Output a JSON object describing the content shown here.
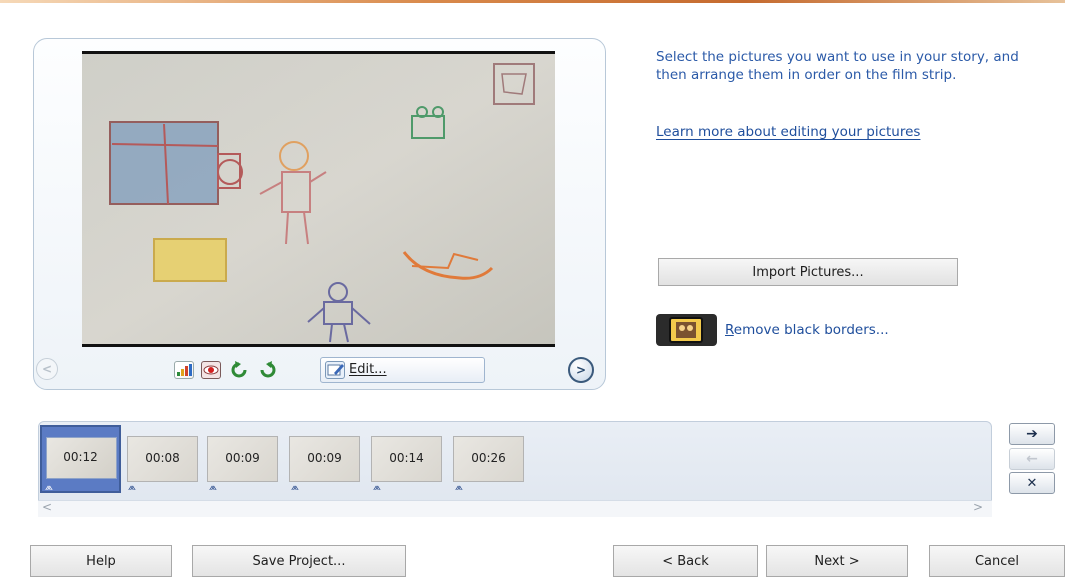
{
  "instructions": "Select the pictures you want to use in your story, and then arrange them in order on the film strip.",
  "learn_more_link": "Learn more about editing your pictures",
  "import_button": "Import Pictures...",
  "remove_borders": {
    "underlined": "R",
    "rest": "emove black borders..."
  },
  "preview_toolbar": {
    "edit_label": "Edit..."
  },
  "filmstrip": {
    "thumbnails": [
      {
        "duration": "00:12",
        "selected": true
      },
      {
        "duration": "00:08",
        "selected": false
      },
      {
        "duration": "00:09",
        "selected": false
      },
      {
        "duration": "00:09",
        "selected": false
      },
      {
        "duration": "00:14",
        "selected": false
      },
      {
        "duration": "00:26",
        "selected": false
      }
    ],
    "scroll_left": "<",
    "scroll_right": ">"
  },
  "side_buttons": {
    "move_right": "➔",
    "move_left": "←",
    "remove": "✕"
  },
  "nav": {
    "prev": "<",
    "next": ">"
  },
  "bottom_buttons": {
    "help": "Help",
    "save_project": "Save Project...",
    "back": "< Back",
    "next": "Next >",
    "cancel": "Cancel"
  },
  "colors": {
    "link": "#1f4e9c",
    "instruction_text": "#2b5aa8",
    "selection": "#5b7bc4"
  }
}
